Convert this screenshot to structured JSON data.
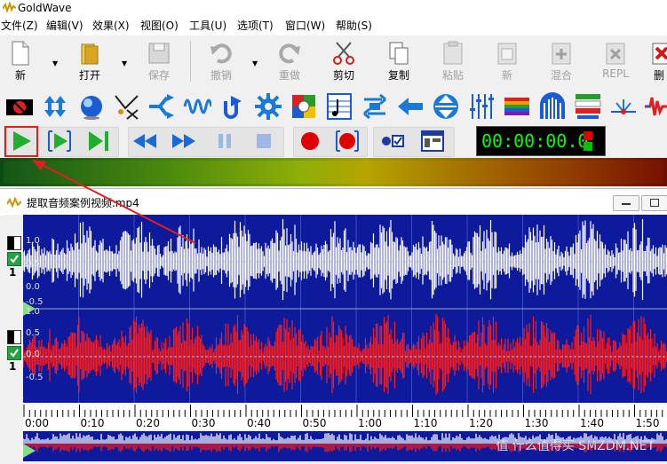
{
  "app": {
    "title": "GoldWave"
  },
  "menu": [
    {
      "label": "文件(Z)"
    },
    {
      "label": "编辑(V)"
    },
    {
      "label": "效果(X)"
    },
    {
      "label": "视图(O)"
    },
    {
      "label": "工具(U)"
    },
    {
      "label": "选项(T)"
    },
    {
      "label": "窗口(W)"
    },
    {
      "label": "帮助(S)"
    }
  ],
  "toolbar": {
    "new": "新",
    "open": "打开",
    "save": "保存",
    "undo": "撤销",
    "redo": "重做",
    "cut": "剪切",
    "copy": "复制",
    "paste": "粘贴",
    "new2": "新",
    "mix": "混合",
    "repl": "REPL",
    "delete": "删"
  },
  "time": {
    "display": "00:00:00.0"
  },
  "document": {
    "title": "提取音频案例视频.mp4",
    "channel1_num": "1",
    "channel2_num": "1",
    "scale": [
      "1.0",
      "0.5",
      "0.0",
      "-0.5",
      "1.0",
      "0.5",
      "0.0",
      "-0.5"
    ]
  },
  "timeline": {
    "ticks": [
      "0:00",
      "0:10",
      "0:20",
      "0:30",
      "0:40",
      "0:50",
      "1:00",
      "1:10",
      "1:20",
      "1:30",
      "1:40",
      "1:50"
    ]
  },
  "colors": {
    "wave_bg": "#0d1a9c",
    "left_channel": "#ffffff",
    "right_channel": "#ff1a1a",
    "annotation": "#e02020",
    "time_text": "#00ff00"
  },
  "watermark": "值 什么值得买 SMZDM.NET"
}
